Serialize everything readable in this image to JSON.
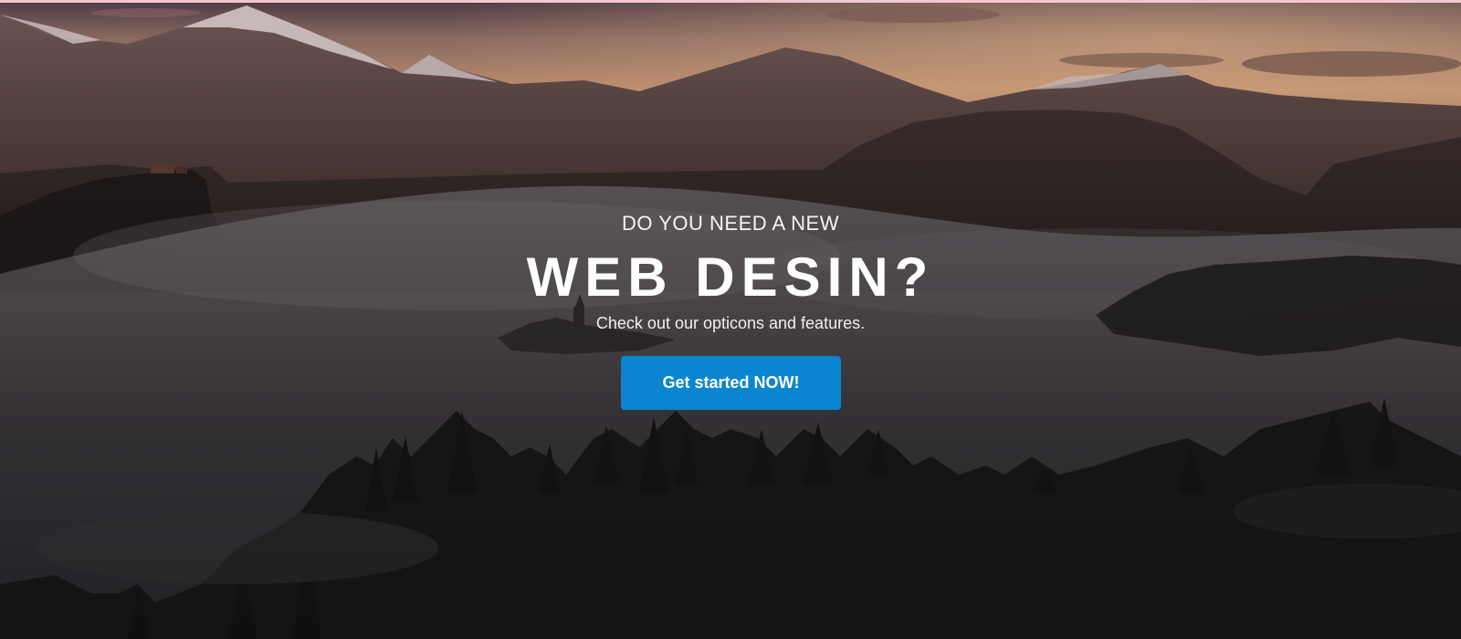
{
  "hero": {
    "eyebrow": "DO YOU NEED A NEW",
    "headline": "WEB DESIN?",
    "subtitle": "Check out our opticons and features.",
    "cta_label": "Get started NOW!",
    "background_image": "foggy-mountain-forest-landscape"
  },
  "colors": {
    "accent": "#0a85d0",
    "top_line": "#f3c8cf",
    "text": "#ffffff"
  }
}
